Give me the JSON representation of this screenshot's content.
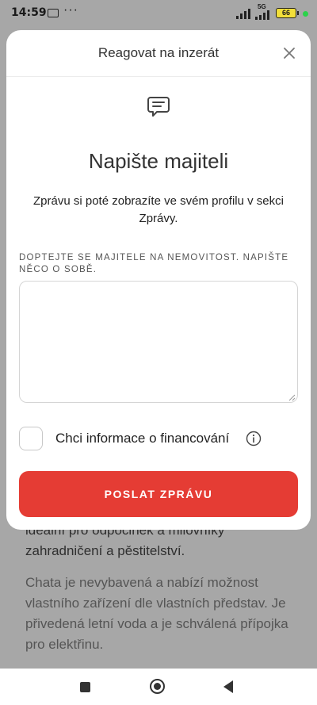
{
  "status_bar": {
    "time": "14:59",
    "notification_icon": "message-app-icon",
    "more_indicator": "···",
    "network": "5G",
    "battery_level": "66"
  },
  "modal": {
    "title": "Reagovat na inzerát",
    "heading": "Napište majiteli",
    "subtext": "Zprávu si poté zobrazíte ve svém profilu v sekci Zprávy.",
    "field_label": "Doptejte se majitele na nemovitost. Napište něco o sobě.",
    "message_value": "",
    "financing_checkbox_label": "Chci informace o financování",
    "financing_checked": false,
    "submit_label": "POSLAT ZPRÁVU"
  },
  "background_page": {
    "paragraph1": "ideální pro odpočinek a milovníky zahradničení a pěstitelství.",
    "paragraph2": "Chata je nevybavená a nabízí možnost vlastního zařízení dle vlastních představ. Je přivedená letní voda a je schválená přípojka pro elektřinu."
  },
  "colors": {
    "accent": "#e53c34",
    "overlay": "#a7a7a7"
  }
}
